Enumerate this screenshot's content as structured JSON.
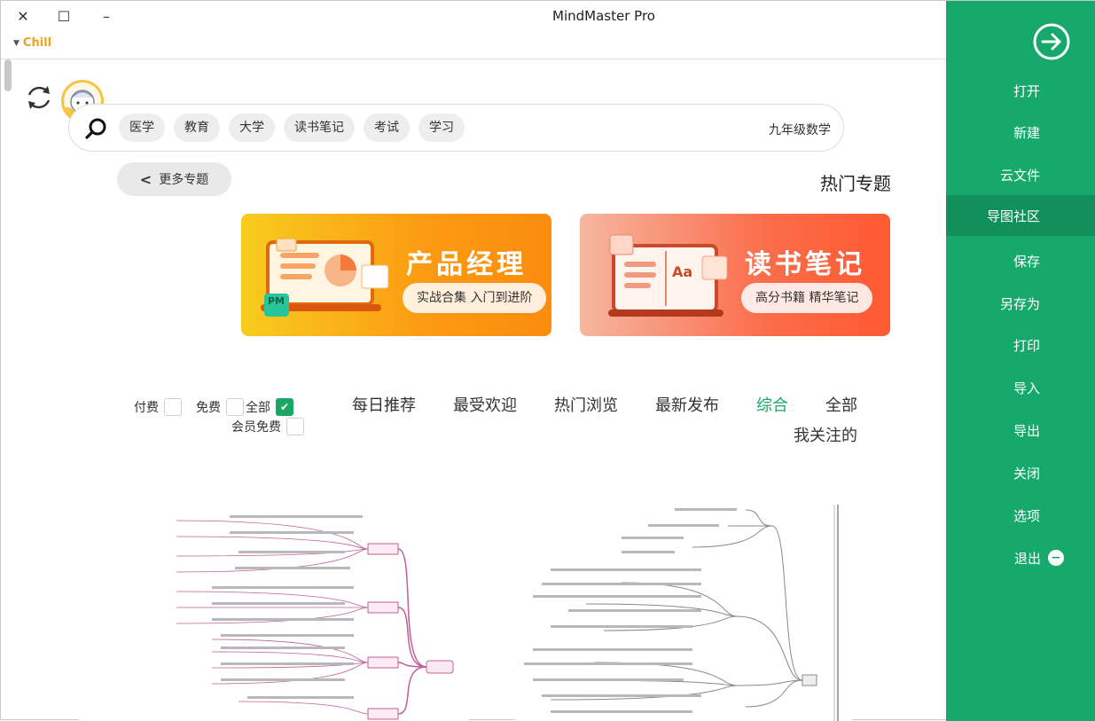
{
  "window": {
    "title": "MindMaster Pro",
    "theme": "Chill",
    "close_glyph": "✕",
    "maximize_glyph": "☐",
    "minimize_glyph": "–"
  },
  "search": {
    "placeholder": "九年级数学",
    "tags": [
      "医学",
      "教育",
      "大学",
      "读书笔记",
      "考试",
      "学习"
    ]
  },
  "hot_topics": {
    "title": "热门专题",
    "more_label": "更多专题",
    "banners": [
      {
        "title": "产品经理",
        "subtitle": "实战合集 入门到进阶",
        "badge": "PM"
      },
      {
        "title": "读书笔记",
        "subtitle": "高分书籍 精华笔记",
        "badge": "Aa"
      }
    ]
  },
  "filters": {
    "tabs": [
      "全部",
      "综合",
      "最新发布",
      "热门浏览",
      "最受欢迎",
      "每日推荐",
      "我关注的"
    ],
    "active_tab": "综合",
    "price_options": [
      {
        "label": "全部",
        "checked": true
      },
      {
        "label": "免费",
        "checked": false
      },
      {
        "label": "付费",
        "checked": false
      },
      {
        "label": "会员免费",
        "checked": false
      }
    ]
  },
  "sidebar": {
    "items": [
      "打开",
      "新建",
      "云文件",
      "导图社区",
      "保存",
      "另存为",
      "打印",
      "导入",
      "导出",
      "关闭",
      "选项",
      "退出"
    ],
    "active": "导图社区"
  },
  "colors": {
    "accent": "#17a96c",
    "sidebar_active": "#12905b",
    "theme_label": "#f0a020",
    "mindmap_branch": "#c0609a"
  },
  "icons": [
    "close-icon",
    "maximize-icon",
    "minimize-icon",
    "refresh-icon",
    "search-icon",
    "chevron-left-icon",
    "back-arrow-icon",
    "exit-icon",
    "check-icon"
  ]
}
